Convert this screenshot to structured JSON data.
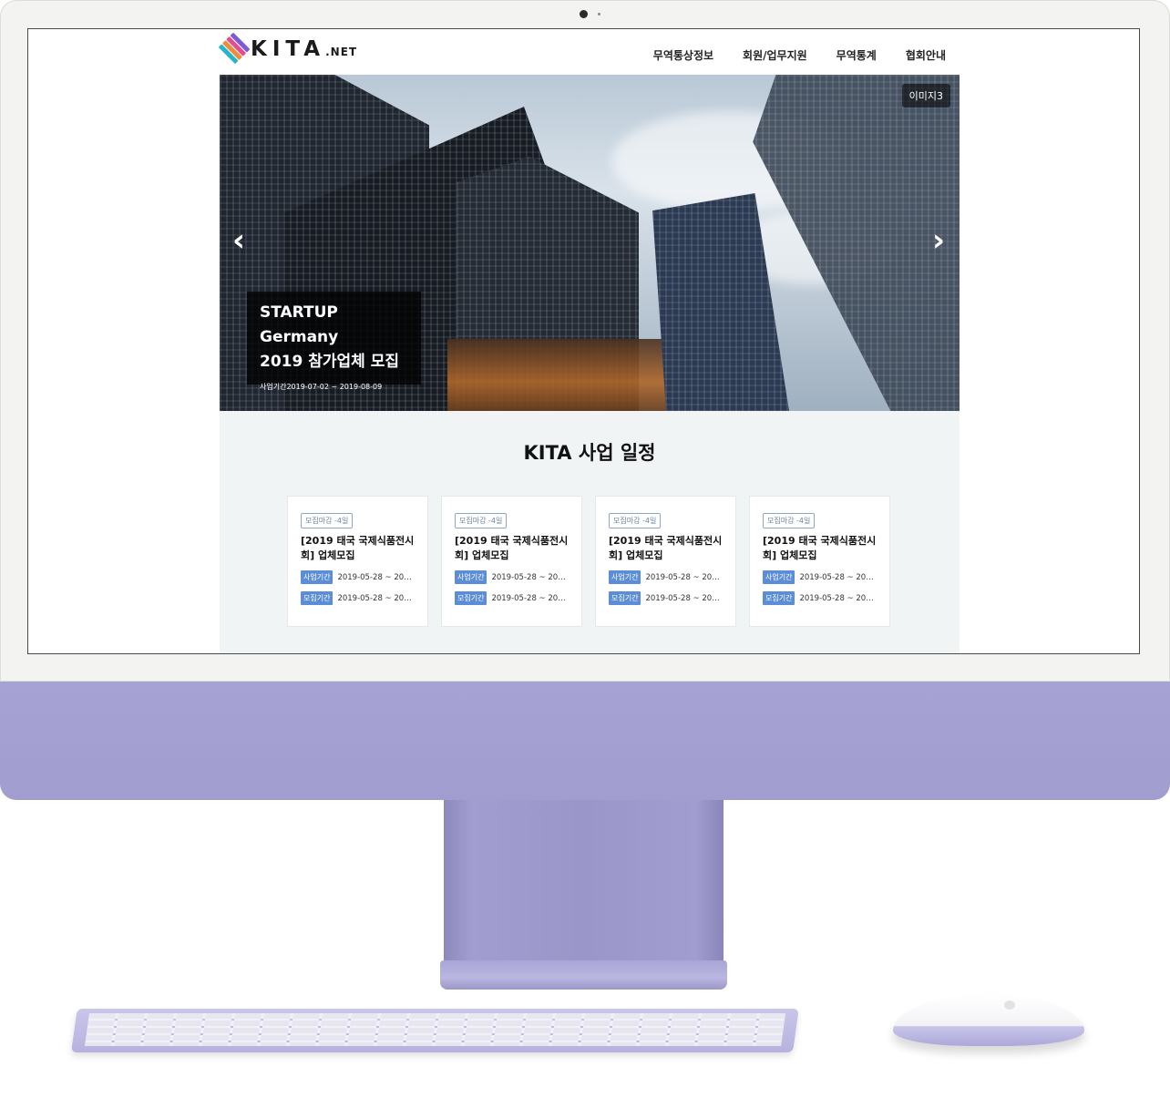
{
  "header": {
    "logo_text": "KITA",
    "logo_sub": ".NET",
    "nav": [
      "무역통상정보",
      "회원/업무지원",
      "무역통계",
      "협회안내"
    ]
  },
  "hero": {
    "image_tag": "이미지3",
    "caption_line1": "STARTUP Germany",
    "caption_line2": "2019 참가업체 모집",
    "caption_period": "사업기간2019-07-02 ~ 2019-08-09",
    "prev": "‹",
    "next": "›"
  },
  "schedule": {
    "title": "KITA 사업 일정",
    "cards": [
      {
        "badge": "모집마감 -4일",
        "title": "[2019 태국 국제식품전시회] 업체모집",
        "label1": "사업기간",
        "value1": "2019-05-28 ~ 20…",
        "label2": "모집기간",
        "value2": "2019-05-28 ~ 20…"
      },
      {
        "badge": "모집마감 -4일",
        "title": "[2019 태국 국제식품전시회] 업체모집",
        "label1": "사업기간",
        "value1": "2019-05-28 ~ 20…",
        "label2": "모집기간",
        "value2": "2019-05-28 ~ 20…"
      },
      {
        "badge": "모집마감 -4일",
        "title": "[2019 태국 국제식품전시회] 업체모집",
        "label1": "사업기간",
        "value1": "2019-05-28 ~ 20…",
        "label2": "모집기간",
        "value2": "2019-05-28 ~ 20…"
      },
      {
        "badge": "모집마감 -4일",
        "title": "[2019 태국 국제식품전시회] 업체모집",
        "label1": "사업기간",
        "value1": "2019-05-28 ~ 20…",
        "label2": "모집기간",
        "value2": "2019-05-28 ~ 20…"
      }
    ]
  },
  "colors": {
    "device_purple": "#a39fd1",
    "badge_blue": "#5b8ed6",
    "schedule_bg": "#f1f4f5"
  }
}
